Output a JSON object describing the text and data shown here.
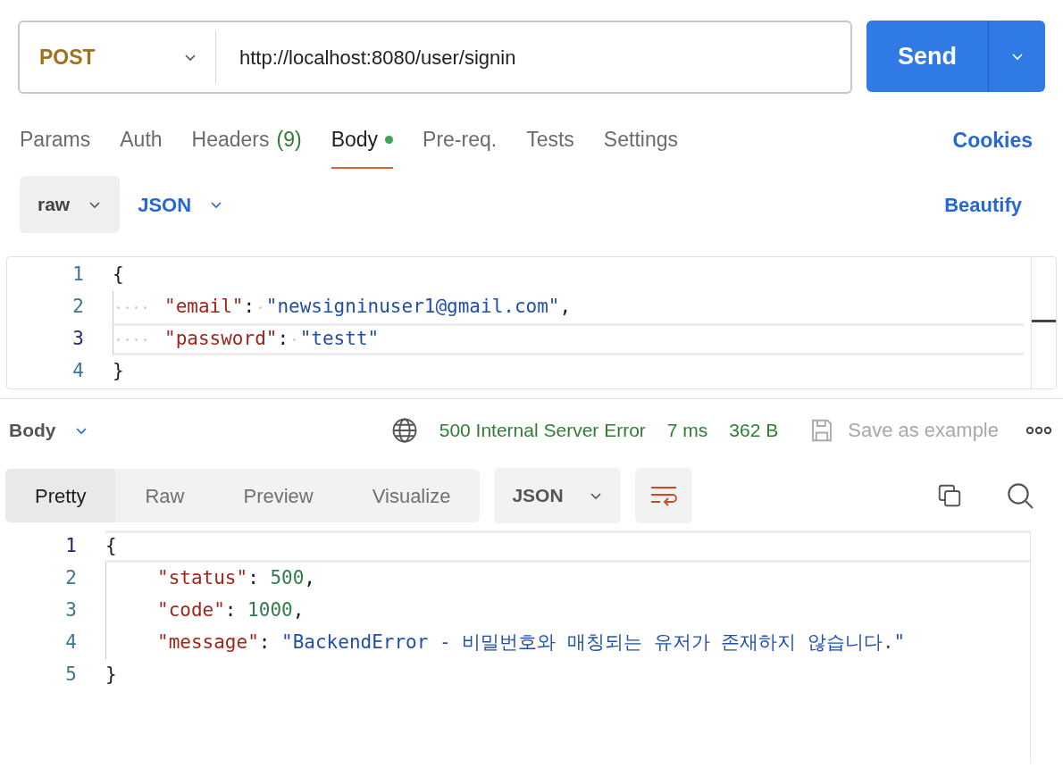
{
  "request": {
    "method": "POST",
    "url": "http://localhost:8080/user/signin",
    "send": "Send"
  },
  "tabs": [
    {
      "label": "Params",
      "selected": false,
      "dot": false
    },
    {
      "label": "Auth",
      "selected": false,
      "dot": false
    },
    {
      "label": "Headers",
      "count": "(9)",
      "selected": false,
      "dot": false
    },
    {
      "label": "Body",
      "selected": true,
      "dot": true
    },
    {
      "label": "Pre-req.",
      "selected": false,
      "dot": false
    },
    {
      "label": "Tests",
      "selected": false,
      "dot": false
    },
    {
      "label": "Settings",
      "selected": false,
      "dot": false
    }
  ],
  "cookies": "Cookies",
  "body_options": {
    "mode": "raw",
    "language": "JSON",
    "beautify": "Beautify"
  },
  "request_editor": {
    "show_whitespace": true,
    "lines": [
      {
        "number": "1",
        "kind": "brace",
        "active": false,
        "tokens": [
          {
            "kind": "punct",
            "text": "{"
          }
        ]
      },
      {
        "number": "2",
        "kind": "member",
        "active": false,
        "tokens": [
          {
            "kind": "key",
            "text": "\"email\""
          },
          {
            "kind": "colon",
            "text": ":"
          },
          {
            "kind": "string",
            "text": "\"newsigninuser1@gmail.com\""
          },
          {
            "kind": "punct",
            "text": ","
          }
        ]
      },
      {
        "number": "3",
        "kind": "member",
        "active": true,
        "tokens": [
          {
            "kind": "key",
            "text": "\"password\""
          },
          {
            "kind": "colon",
            "text": ":"
          },
          {
            "kind": "string",
            "text": "\"testt\""
          }
        ]
      },
      {
        "number": "4",
        "kind": "brace",
        "active": false,
        "tokens": [
          {
            "kind": "punct",
            "text": "}"
          }
        ]
      }
    ]
  },
  "response": {
    "label": "Body",
    "status": "500 Internal Server Error",
    "time": "7 ms",
    "size": "362 B",
    "save": "Save as example",
    "views": [
      {
        "label": "Pretty",
        "selected": true
      },
      {
        "label": "Raw",
        "selected": false
      },
      {
        "label": "Preview",
        "selected": false
      },
      {
        "label": "Visualize",
        "selected": false
      }
    ],
    "format": "JSON"
  },
  "response_editor": {
    "lines": [
      {
        "number": "1",
        "kind": "brace",
        "active": true,
        "tokens": [
          {
            "kind": "punct",
            "text": "{"
          }
        ]
      },
      {
        "number": "2",
        "kind": "member",
        "active": false,
        "tokens": [
          {
            "kind": "key",
            "text": "\"status\""
          },
          {
            "kind": "colon",
            "text": ":"
          },
          {
            "kind": "number",
            "text": "500"
          },
          {
            "kind": "punct",
            "text": ","
          }
        ]
      },
      {
        "number": "3",
        "kind": "member",
        "active": false,
        "tokens": [
          {
            "kind": "key",
            "text": "\"code\""
          },
          {
            "kind": "colon",
            "text": ":"
          },
          {
            "kind": "number",
            "text": "1000"
          },
          {
            "kind": "punct",
            "text": ","
          }
        ]
      },
      {
        "number": "4",
        "kind": "member",
        "active": false,
        "tokens": [
          {
            "kind": "key",
            "text": "\"message\""
          },
          {
            "kind": "colon",
            "text": ":"
          },
          {
            "kind": "string",
            "text": "\"BackendError - 비밀번호와 매칭되는 유저가 존재하지 않습니다.\""
          }
        ]
      },
      {
        "number": "5",
        "kind": "brace",
        "active": false,
        "tokens": [
          {
            "kind": "punct",
            "text": "}"
          }
        ]
      }
    ]
  }
}
